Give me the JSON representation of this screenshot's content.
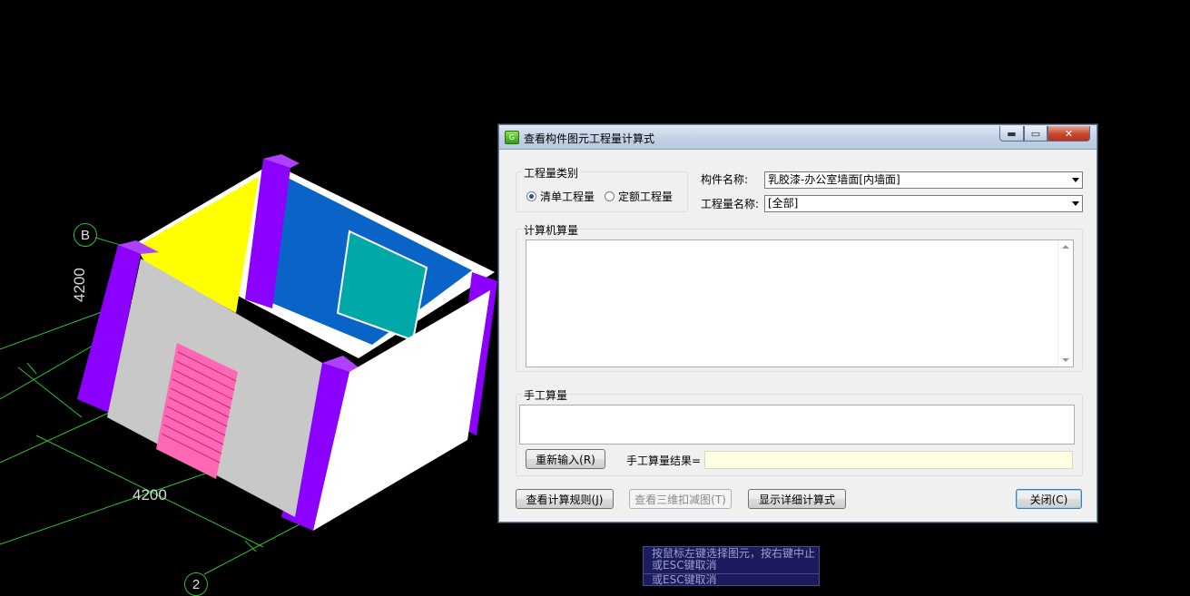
{
  "scene": {
    "axis_bubble_b": "B",
    "axis_bubble_2": "2",
    "dim_vertical": "4200",
    "dim_horizontal": "4200"
  },
  "dialog": {
    "title": "查看构件图元工程量计算式",
    "window_controls": {
      "minimize": "▬",
      "maximize": "▭",
      "close": "✕"
    },
    "quantity_type": {
      "group_label": "工程量类别",
      "options": [
        {
          "label": "清单工程量",
          "selected": true
        },
        {
          "label": "定额工程量",
          "selected": false
        }
      ]
    },
    "component_name_label": "构件名称:",
    "component_name_value": "乳胶漆-办公室墙面[内墙面]",
    "quantity_name_label": "工程量名称:",
    "quantity_name_value": "[全部]",
    "computer_calc": {
      "group_label": "计算机算量",
      "content": ""
    },
    "manual_calc": {
      "group_label": "手工算量",
      "content": "",
      "reenter_button": "重新输入(R)",
      "result_label": "手工算量结果=",
      "result_value": ""
    },
    "buttons": {
      "view_rules": "查看计算规则(J)",
      "view_3d_deduction": "查看三维扣减图(T)",
      "show_detail": "显示详细计算式",
      "close": "关闭(C)"
    }
  },
  "status_tip": {
    "line1": "按鼠标左键选择图元，按右键中止",
    "line2": "或ESC键取消",
    "line3": "或ESC键取消"
  },
  "colors": {
    "background": "#000000",
    "wall_purple": "#8b00ff",
    "wall_blue": "#0a64c8",
    "wall_yellow": "#ffff00",
    "window_teal": "#00a8a8",
    "door_pink": "#ff69b4",
    "axis_green": "#2fbf2f"
  }
}
